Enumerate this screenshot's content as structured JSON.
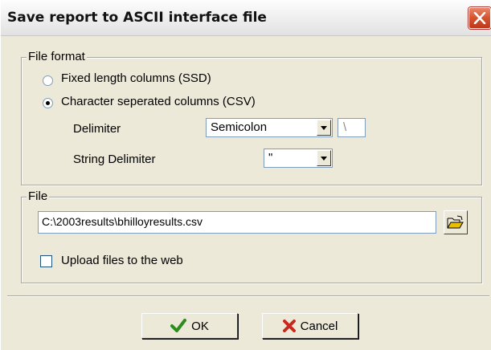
{
  "window": {
    "title": "Save report to ASCII interface file"
  },
  "file_format": {
    "legend": "File format",
    "options": [
      {
        "label": "Fixed length columns (SSD)",
        "checked": false
      },
      {
        "label": "Character seperated columns (CSV)",
        "checked": true
      }
    ],
    "delimiter_label": "Delimiter",
    "delimiter_value": "Semicolon",
    "delimiter_custom": "\\",
    "string_delimiter_label": "String Delimiter",
    "string_delimiter_value": "\""
  },
  "file": {
    "legend": "File",
    "path": "C:\\2003results\\bhilloyresults.csv",
    "upload_label": "Upload files to the web",
    "upload_checked": false
  },
  "buttons": {
    "ok": "OK",
    "cancel": "Cancel"
  },
  "colors": {
    "ok_check": "#2e8b1e",
    "cancel_x": "#c8281e"
  }
}
